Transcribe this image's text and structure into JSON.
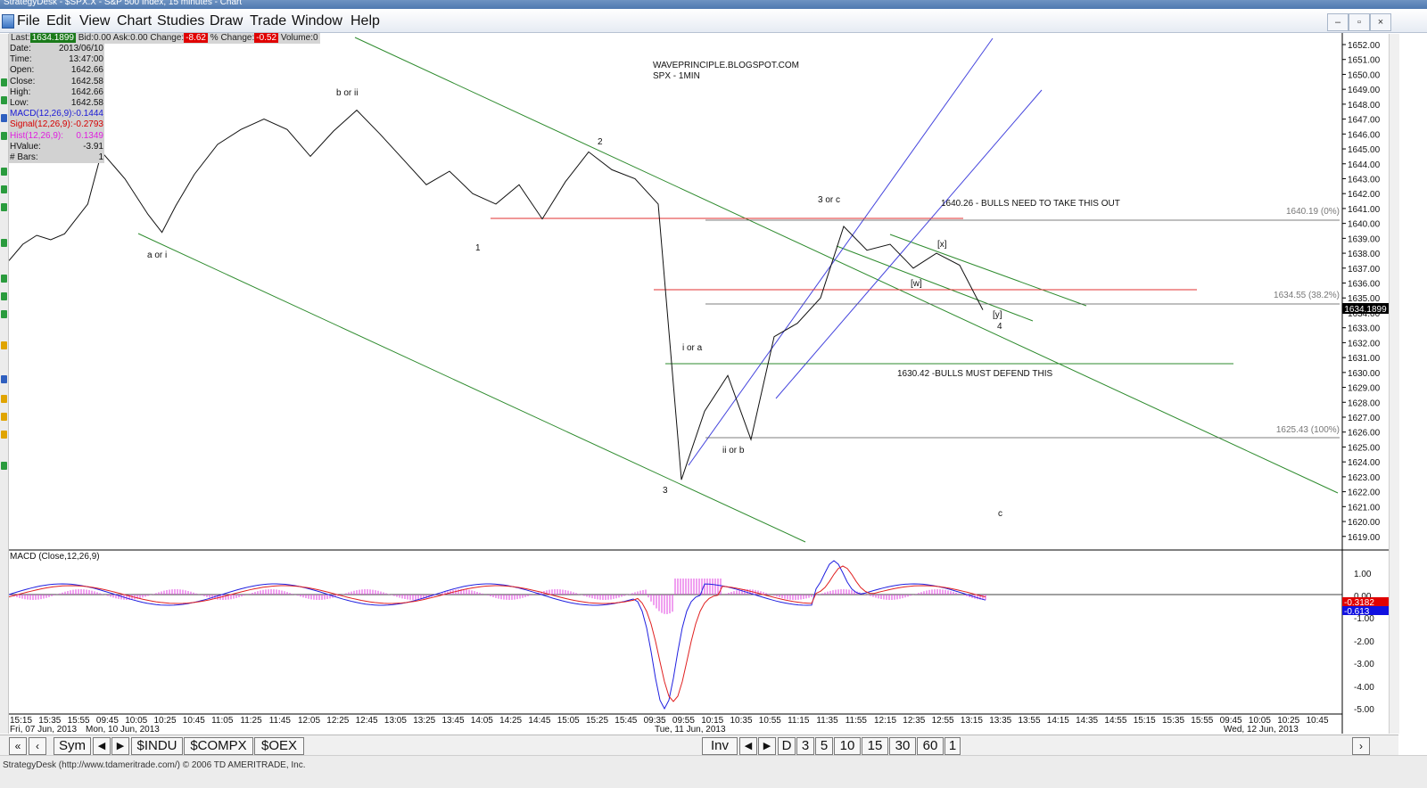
{
  "window": {
    "title": "StrategyDesk - $SPX.X - S&P 500 Index, 15 minutes - Chart",
    "status_text": "StrategyDesk (http://www.tdameritrade.com/) © 2006 TD AMERITRADE, Inc."
  },
  "menu": [
    "File",
    "Edit",
    "View",
    "Chart",
    "Studies",
    "Draw",
    "Trade",
    "Window",
    "Help"
  ],
  "window_controls": [
    "–",
    "▫",
    "×"
  ],
  "quote_bar": {
    "last_label": "Last:",
    "last": "1634.1899",
    "bid_label": "Bid:",
    "bid": "0.00",
    "ask_label": "Ask:",
    "ask": "0.00",
    "change_label": "Change:",
    "change": "-8.62",
    "pct_change_label": "% Change:",
    "pct_change": "-0.52",
    "volume_label": "Volume:",
    "volume": "0"
  },
  "info_box": [
    {
      "k": "Date:",
      "v": "2013/06/10",
      "color": "#111111"
    },
    {
      "k": "Time:",
      "v": "13:47:00",
      "color": "#111111"
    },
    {
      "k": "Open:",
      "v": "1642.66",
      "color": "#111111"
    },
    {
      "k": "Close:",
      "v": "1642.58",
      "color": "#111111"
    },
    {
      "k": "High:",
      "v": "1642.66",
      "color": "#111111"
    },
    {
      "k": "Low:",
      "v": "1642.58",
      "color": "#111111"
    },
    {
      "k": "MACD(12,26,9):",
      "v": "-0.1444",
      "color": "#1a1ad6"
    },
    {
      "k": "Signal(12,26,9):",
      "v": "-0.2793",
      "color": "#d60000"
    },
    {
      "k": "Hist(12,26,9):",
      "v": "0.1349",
      "color": "#e020e0"
    },
    {
      "k": "HValue:",
      "v": "-3.91",
      "color": "#111111"
    },
    {
      "k": "# Bars:",
      "v": "1",
      "color": "#111111"
    }
  ],
  "header_text": [
    "WAVEPRINCIPLE.BLOGSPOT.COM",
    "SPX - 1MIN"
  ],
  "price_axis": [
    "1652.00",
    "1651.00",
    "1650.00",
    "1649.00",
    "1648.00",
    "1647.00",
    "1646.00",
    "1645.00",
    "1644.00",
    "1643.00",
    "1642.00",
    "1641.00",
    "1640.00",
    "1639.00",
    "1638.00",
    "1637.00",
    "1636.00",
    "1635.00",
    "1634.00",
    "1633.00",
    "1632.00",
    "1631.00",
    "1630.00",
    "1629.00",
    "1628.00",
    "1627.00",
    "1626.00",
    "1625.00",
    "1624.00",
    "1623.00",
    "1622.00",
    "1621.00",
    "1620.00",
    "1619.00"
  ],
  "last_price_tag": "1634.1899",
  "macd_panel": {
    "label": "MACD (Close,12,26,9)",
    "axis": [
      "1.00",
      "0.00",
      "-1.00",
      "-2.00",
      "-3.00",
      "-4.00",
      "-5.00"
    ],
    "signal_tag": "-0.3182",
    "macd_tag": "-0.613"
  },
  "time_axis": [
    "15:15",
    "15:35",
    "15:55",
    "09:45",
    "10:05",
    "10:25",
    "10:45",
    "11:05",
    "11:25",
    "11:45",
    "12:05",
    "12:25",
    "12:45",
    "13:05",
    "13:25",
    "13:45",
    "14:05",
    "14:25",
    "14:45",
    "15:05",
    "15:25",
    "15:45",
    "09:35",
    "09:55",
    "10:15",
    "10:35",
    "10:55",
    "11:15",
    "11:35",
    "11:55",
    "12:15",
    "12:35",
    "12:55",
    "13:15",
    "13:35",
    "13:55",
    "14:15",
    "14:35",
    "14:55",
    "15:15",
    "15:35",
    "15:55",
    "09:45",
    "10:05",
    "10:25",
    "10:45"
  ],
  "date_labels": [
    "Fri, 07 Jun, 2013",
    "Mon, 10 Jun, 2013",
    "Tue, 11 Jun, 2013",
    "Wed, 12 Jun, 2013"
  ],
  "annotations": {
    "b_or_ii": "b or ii",
    "a_or_i": "a or i",
    "two": "2",
    "one": "1",
    "three": "3",
    "i_or_a": "i or a",
    "ii_or_b": "ii or b",
    "three_or_c": "3 or c",
    "x": "[x]",
    "w": "[w]",
    "y": "[y]",
    "four": "4",
    "c": "c",
    "bulls_take_out": "1640.26 - BULLS NEED TO TAKE THIS OUT",
    "bulls_defend": "1630.42 -BULLS MUST DEFEND THIS",
    "fib_0": "1640.19 (0%)",
    "fib_382": "1634.55 (38.2%)",
    "fib_100": "1625.43 (100%)"
  },
  "bottom_tabs": {
    "nav_left": [
      "«",
      "‹"
    ],
    "sym": "Sym",
    "sym_nav": [
      "◀",
      "▶"
    ],
    "symbols": [
      "$INDU",
      "$COMPX",
      "$OEX"
    ],
    "inv": "Inv",
    "inv_nav": [
      "◀",
      "▶"
    ],
    "periods": [
      "D",
      "3",
      "5",
      "10",
      "15",
      "30",
      "60",
      "1"
    ],
    "nav_right": "›"
  },
  "chart_data": {
    "type": "line",
    "title": "WAVEPRINCIPLE.BLOGSPOT.COM",
    "subtitle": "SPX - 1MIN",
    "ylim": [
      1618.5,
      1652.6
    ],
    "series": [
      {
        "name": "",
        "x_index": [
          0,
          3,
          6,
          9,
          12,
          17,
          20,
          25,
          30,
          33,
          36,
          40,
          45,
          50,
          55,
          60,
          65,
          70,
          75,
          80,
          85,
          90,
          95,
          100,
          105,
          110,
          115,
          120,
          125,
          130,
          135,
          140,
          145,
          150,
          155,
          160,
          165,
          170,
          175,
          180,
          185,
          190,
          195,
          200,
          205,
          210
        ],
        "values": [
          1637.5,
          1638.6,
          1639.2,
          1638.9,
          1639.3,
          1641.3,
          1644.8,
          1643.0,
          1640.6,
          1639.4,
          1641.2,
          1643.3,
          1645.3,
          1646.3,
          1647.0,
          1646.3,
          1644.5,
          1646.2,
          1647.6,
          1646.0,
          1644.3,
          1642.6,
          1643.5,
          1642.0,
          1641.3,
          1642.6,
          1640.3,
          1642.8,
          1644.8,
          1643.6,
          1643.0,
          1641.3,
          1622.8,
          1627.4,
          1629.8,
          1625.5,
          1632.4,
          1633.3,
          1635.0,
          1639.8,
          1638.2,
          1638.6,
          1637.0,
          1638.0,
          1637.2,
          1634.2
        ]
      }
    ],
    "levels": [
      1640.26,
      1640.19,
      1634.55,
      1630.42,
      1625.43
    ]
  }
}
